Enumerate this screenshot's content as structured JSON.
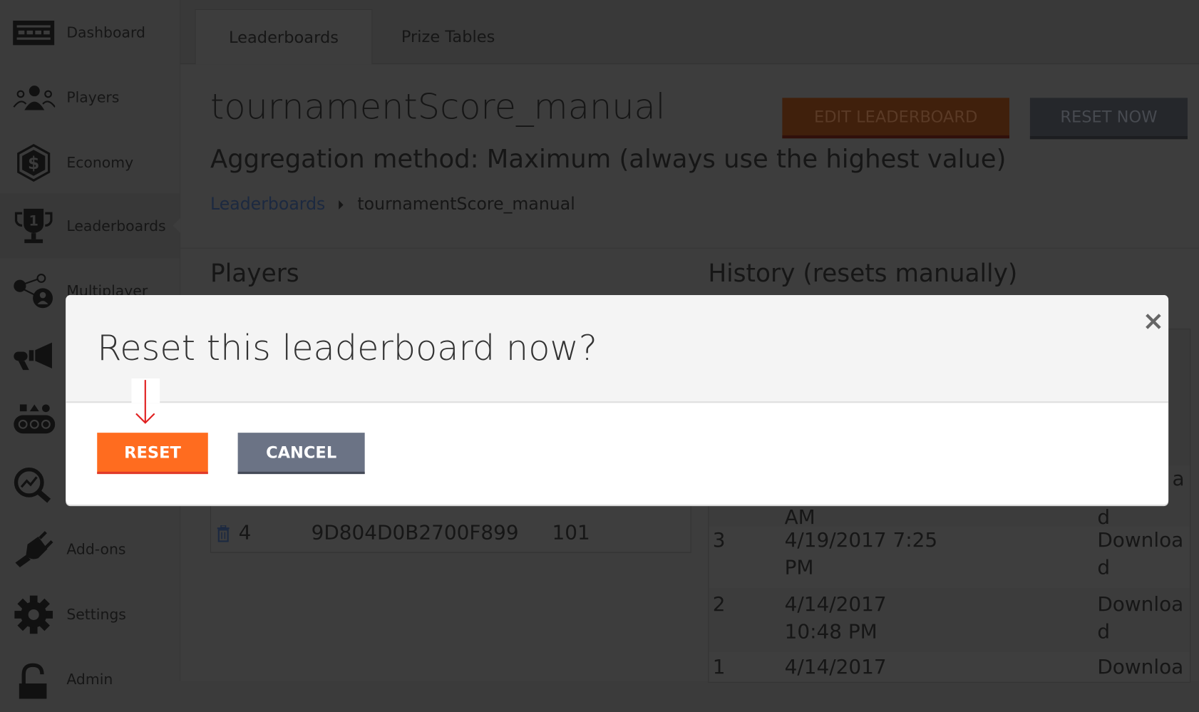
{
  "sidebar": {
    "items": [
      {
        "label": "Dashboard",
        "icon": "dashboard-icon"
      },
      {
        "label": "Players",
        "icon": "players-icon"
      },
      {
        "label": "Economy",
        "icon": "economy-icon"
      },
      {
        "label": "Leaderboards",
        "icon": "trophy-icon",
        "active": true
      },
      {
        "label": "Multiplayer",
        "icon": "multiplayer-icon"
      },
      {
        "label": "",
        "icon": "megaphone-icon"
      },
      {
        "label": "",
        "icon": "content-icon"
      },
      {
        "label": "",
        "icon": "analytics-icon"
      },
      {
        "label": "Add-ons",
        "icon": "plug-icon"
      },
      {
        "label": "Settings",
        "icon": "gear-icon"
      },
      {
        "label": "Admin",
        "icon": "lock-icon"
      }
    ]
  },
  "tabs": [
    {
      "label": "Leaderboards",
      "active": true
    },
    {
      "label": "Prize Tables",
      "active": false
    }
  ],
  "header": {
    "title": "tournamentScore_manual",
    "subtitle": "Aggregation method: Maximum (always use the highest value)",
    "edit_label": "EDIT LEADERBOARD",
    "reset_now_label": "RESET NOW"
  },
  "breadcrumb": {
    "root": "Leaderboards",
    "current": "tournamentScore_manual"
  },
  "players": {
    "heading": "Players",
    "rows": [
      {
        "rank": "4",
        "id": "9D804D0B2700F899",
        "value": "101"
      }
    ]
  },
  "history": {
    "heading": "History (resets manually)",
    "partial_row": {
      "date_tail": "AM",
      "link_head": "a",
      "link_tail": "d"
    },
    "rows": [
      {
        "num": "3",
        "date1": "4/19/2017 7:25",
        "date2": "PM",
        "link1": "Downloa",
        "link2": "d"
      },
      {
        "num": "2",
        "date1": "4/14/2017",
        "date2": "10:48 PM",
        "link1": "Downloa",
        "link2": "d"
      },
      {
        "num": "1",
        "date1": "4/14/2017",
        "date2": "",
        "link1": "Downloa",
        "link2": ""
      }
    ]
  },
  "modal": {
    "title": "Reset this leaderboard now?",
    "close": "×",
    "reset_label": "RESET",
    "cancel_label": "CANCEL"
  },
  "colors": {
    "accent": "#ff6c1f",
    "cancel": "#6b7385",
    "annotation": "#e02020"
  }
}
